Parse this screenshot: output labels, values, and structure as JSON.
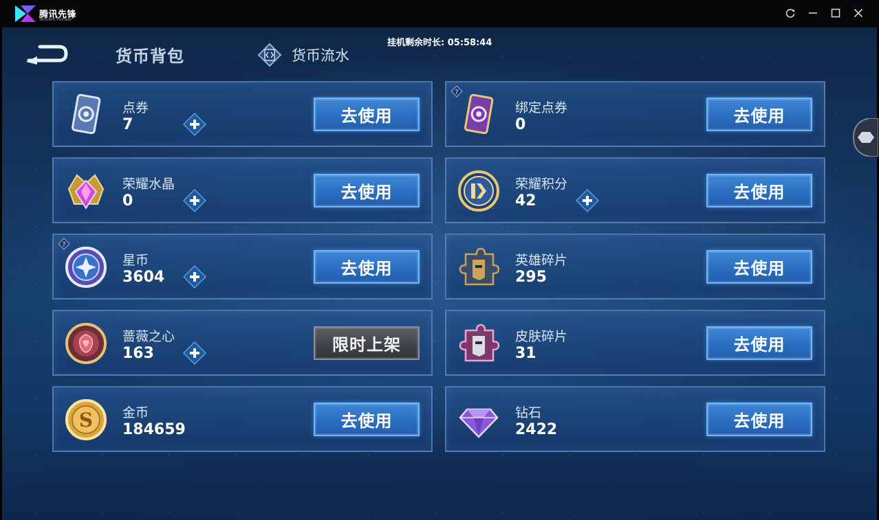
{
  "titlebar": {
    "app_name": "腾讯先锋",
    "app_name_en": "Tencent Pioneer",
    "icons": [
      "logo-icon",
      "refresh-icon",
      "minimize-icon",
      "maximize-icon",
      "close-icon"
    ]
  },
  "header": {
    "timer_text": "挂机剩余时长: 05:58:44",
    "tab_main": "货币背包",
    "tab_flow": "货币流水"
  },
  "button_labels": {
    "use": "去使用",
    "limited": "限时上架"
  },
  "currencies": [
    {
      "name": "点券",
      "value": "7",
      "plus": true,
      "help": false,
      "button": "去使用",
      "icon": "ticket-card-icon"
    },
    {
      "name": "绑定点券",
      "value": "0",
      "plus": false,
      "help": true,
      "button": "去使用",
      "icon": "bound-ticket-card-icon"
    },
    {
      "name": "荣耀水晶",
      "value": "0",
      "plus": true,
      "help": false,
      "button": "去使用",
      "icon": "glory-crystal-icon"
    },
    {
      "name": "荣耀积分",
      "value": "42",
      "plus": true,
      "help": false,
      "button": "去使用",
      "icon": "glory-points-icon"
    },
    {
      "name": "星币",
      "value": "3604",
      "plus": true,
      "help": true,
      "button": "去使用",
      "icon": "star-coin-icon"
    },
    {
      "name": "英雄碎片",
      "value": "295",
      "plus": false,
      "help": false,
      "button": "去使用",
      "icon": "hero-fragment-icon"
    },
    {
      "name": "蔷薇之心",
      "value": "163",
      "plus": true,
      "help": false,
      "button": "限时上架",
      "icon": "rose-heart-icon"
    },
    {
      "name": "皮肤碎片",
      "value": "31",
      "plus": false,
      "help": false,
      "button": "去使用",
      "icon": "skin-fragment-icon"
    },
    {
      "name": "金币",
      "value": "184659",
      "plus": false,
      "help": false,
      "button": "去使用",
      "icon": "gold-coin-icon"
    },
    {
      "name": "钻石",
      "value": "2422",
      "plus": false,
      "help": false,
      "button": "去使用",
      "icon": "diamond-icon"
    }
  ],
  "colors": {
    "button_blue": "#2a6ec0",
    "button_gray": "#3e4247",
    "card_border": "#78a5dc",
    "background": "#17406f"
  }
}
